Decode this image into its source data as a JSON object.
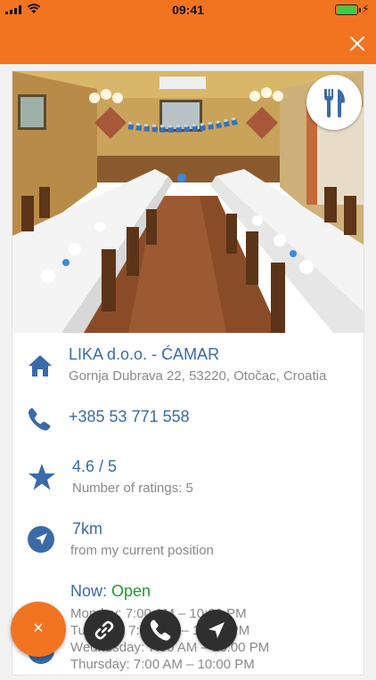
{
  "status_bar": {
    "time": "09:41"
  },
  "place": {
    "name": "LIKA d.o.o. - ĆAMAR",
    "address": "Gornja Dubrava 22, 53220, Otočac, Croatia",
    "phone": "+385 53 771 558",
    "rating": "4.6 / 5",
    "ratings_count": "Number of ratings: 5",
    "distance": "7km",
    "distance_sub": "from my current position",
    "now_label": "Now: ",
    "now_status": "Open",
    "hours": [
      "Monday: 7:00 AM – 10:00 PM",
      "Tuesday: 7:00 AM – 10:00 PM",
      "Wednesday: 7:00 AM – 10:00 PM",
      "Thursday: 7:00 AM – 10:00 PM"
    ]
  },
  "fab": {
    "label": "×"
  },
  "icons": {
    "category": "fork-knife-icon",
    "address": "home-icon",
    "phone": "phone-icon",
    "rating": "star-icon",
    "distance": "navigation-arrow-icon",
    "hours": "clock-icon",
    "link": "link-icon",
    "call": "phone-icon",
    "navigate": "navigation-arrow-icon"
  },
  "colors": {
    "accent": "#f27420",
    "link_blue": "#3a6aa8",
    "open_green": "#1f9a2e",
    "secondary_text": "#8a8a8a"
  }
}
